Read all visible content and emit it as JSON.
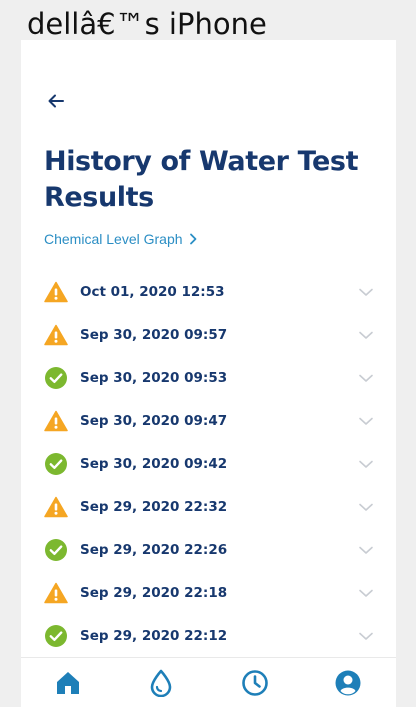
{
  "device_label": "dellâ€™s iPhone",
  "header": {
    "title": "History of Water Test Results",
    "graph_link_label": "Chemical Level Graph"
  },
  "results": [
    {
      "date": "Oct 01, 2020 12:53",
      "status": "warning"
    },
    {
      "date": "Sep 30, 2020 09:57",
      "status": "warning"
    },
    {
      "date": "Sep 30, 2020 09:53",
      "status": "ok"
    },
    {
      "date": "Sep 30, 2020 09:47",
      "status": "warning"
    },
    {
      "date": "Sep 30, 2020 09:42",
      "status": "ok"
    },
    {
      "date": "Sep 29, 2020 22:32",
      "status": "warning"
    },
    {
      "date": "Sep 29, 2020 22:26",
      "status": "ok"
    },
    {
      "date": "Sep 29, 2020 22:18",
      "status": "warning"
    },
    {
      "date": "Sep 29, 2020 22:12",
      "status": "ok"
    }
  ],
  "tabs": [
    {
      "name": "home",
      "icon": "home-icon",
      "active": true
    },
    {
      "name": "water",
      "icon": "water-drop-icon",
      "active": false
    },
    {
      "name": "history",
      "icon": "clock-icon",
      "active": false
    },
    {
      "name": "profile",
      "icon": "profile-icon",
      "active": false
    }
  ],
  "colors": {
    "primary": "#17386e",
    "link": "#2b8ec4",
    "warning": "#f5a623",
    "ok": "#7cb82f",
    "tab": "#1e7fb8",
    "chevron": "#c8ccd2"
  }
}
